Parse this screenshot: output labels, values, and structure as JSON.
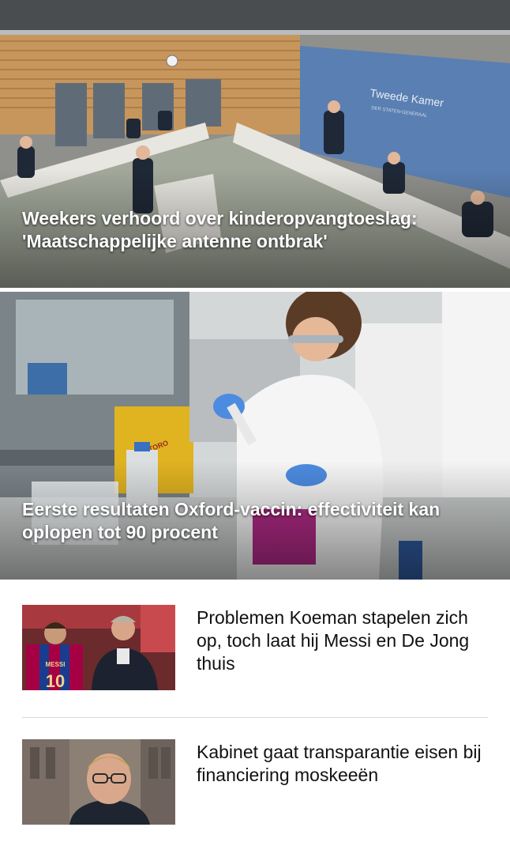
{
  "articles": {
    "hero1": {
      "headline": "Weekers verhoord over kinderopvangtoeslag: 'Maatschappelijke antenne ontbrak'"
    },
    "hero2": {
      "headline": "Eerste resultaten Oxford-vaccin: effectiviteit kan oplopen tot 90 procent"
    },
    "list": [
      {
        "headline": "Problemen Koeman stapelen zich op, toch laat hij Messi en De Jong thuis"
      },
      {
        "headline": "Kabinet gaat transparantie eisen bij financiering moskeeën"
      }
    ]
  },
  "image_text": {
    "parliament_sign": "Tweede Kamer",
    "parliament_sign_sub": "DER STATEN-GENERAAL",
    "jersey_name": "MESSI",
    "jersey_number": "10",
    "container_label": "PETORO"
  },
  "colors": {
    "headline_overlay": "#ffffff",
    "list_text": "#111111",
    "divider": "#d8d8d8"
  }
}
